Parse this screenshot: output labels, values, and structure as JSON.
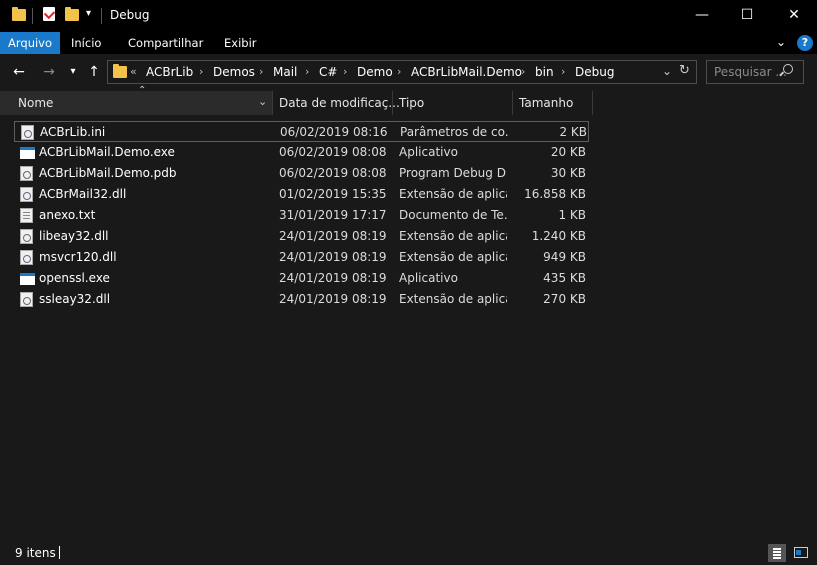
{
  "window": {
    "title": "Debug",
    "minimize_glyph": "—",
    "maximize_glyph": "☐",
    "close_glyph": "✕"
  },
  "ribbon": {
    "tabs": [
      "Arquivo",
      "Início",
      "Compartilhar",
      "Exibir"
    ],
    "help_glyph": "?"
  },
  "address": {
    "overflow": "«",
    "crumbs": [
      "ACBrLib",
      "Demos",
      "Mail",
      "C#",
      "Demo",
      "ACBrLibMail.Demo",
      "bin",
      "Debug"
    ]
  },
  "search": {
    "placeholder": "Pesquisar ..."
  },
  "columns": {
    "name": "Nome",
    "date": "Data de modificaç...",
    "type": "Tipo",
    "size": "Tamanho"
  },
  "files": [
    {
      "name": "ACBrLib.ini",
      "date": "06/02/2019 08:16",
      "type": "Parâmetros de co...",
      "size": "2 KB",
      "icon": "ini-file-icon"
    },
    {
      "name": "ACBrLibMail.Demo.exe",
      "date": "06/02/2019 08:08",
      "type": "Aplicativo",
      "size": "20 KB",
      "icon": "exe-file-icon"
    },
    {
      "name": "ACBrLibMail.Demo.pdb",
      "date": "06/02/2019 08:08",
      "type": "Program Debug D...",
      "size": "30 KB",
      "icon": "pdb-file-icon"
    },
    {
      "name": "ACBrMail32.dll",
      "date": "01/02/2019 15:35",
      "type": "Extensão de aplica...",
      "size": "16.858 KB",
      "icon": "dll-file-icon"
    },
    {
      "name": "anexo.txt",
      "date": "31/01/2019 17:17",
      "type": "Documento de Te...",
      "size": "1 KB",
      "icon": "txt-file-icon"
    },
    {
      "name": "libeay32.dll",
      "date": "24/01/2019 08:19",
      "type": "Extensão de aplica...",
      "size": "1.240 KB",
      "icon": "dll-file-icon"
    },
    {
      "name": "msvcr120.dll",
      "date": "24/01/2019 08:19",
      "type": "Extensão de aplica...",
      "size": "949 KB",
      "icon": "dll-file-icon"
    },
    {
      "name": "openssl.exe",
      "date": "24/01/2019 08:19",
      "type": "Aplicativo",
      "size": "435 KB",
      "icon": "exe-file-icon"
    },
    {
      "name": "ssleay32.dll",
      "date": "24/01/2019 08:19",
      "type": "Extensão de aplica...",
      "size": "270 KB",
      "icon": "dll-file-icon"
    }
  ],
  "status": {
    "count": "9 itens"
  },
  "colors": {
    "accent": "#1979ca",
    "folder": "#f3c24b",
    "background": "#191919"
  }
}
